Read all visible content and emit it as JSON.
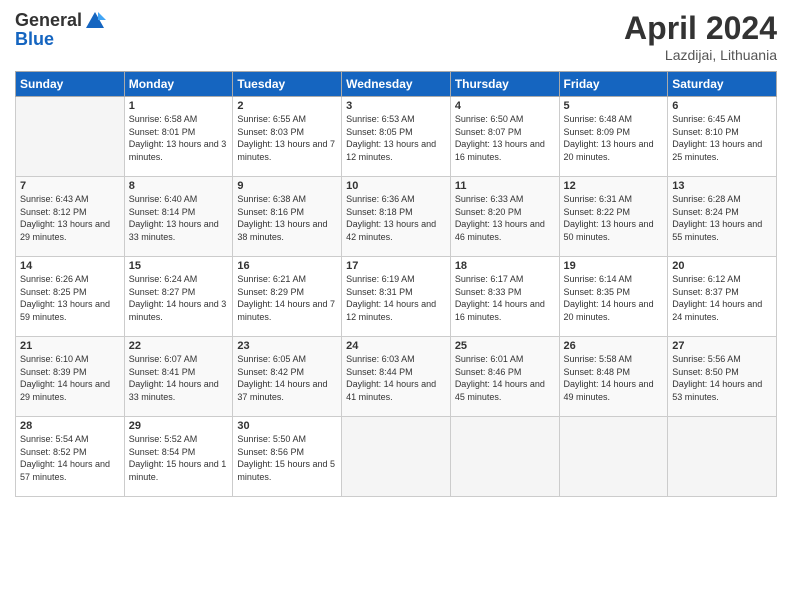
{
  "logo": {
    "general": "General",
    "blue": "Blue"
  },
  "header": {
    "title": "April 2024",
    "subtitle": "Lazdijai, Lithuania"
  },
  "weekdays": [
    "Sunday",
    "Monday",
    "Tuesday",
    "Wednesday",
    "Thursday",
    "Friday",
    "Saturday"
  ],
  "weeks": [
    [
      {
        "day": "",
        "sunrise": "",
        "sunset": "",
        "daylight": ""
      },
      {
        "day": "1",
        "sunrise": "Sunrise: 6:58 AM",
        "sunset": "Sunset: 8:01 PM",
        "daylight": "Daylight: 13 hours and 3 minutes."
      },
      {
        "day": "2",
        "sunrise": "Sunrise: 6:55 AM",
        "sunset": "Sunset: 8:03 PM",
        "daylight": "Daylight: 13 hours and 7 minutes."
      },
      {
        "day": "3",
        "sunrise": "Sunrise: 6:53 AM",
        "sunset": "Sunset: 8:05 PM",
        "daylight": "Daylight: 13 hours and 12 minutes."
      },
      {
        "day": "4",
        "sunrise": "Sunrise: 6:50 AM",
        "sunset": "Sunset: 8:07 PM",
        "daylight": "Daylight: 13 hours and 16 minutes."
      },
      {
        "day": "5",
        "sunrise": "Sunrise: 6:48 AM",
        "sunset": "Sunset: 8:09 PM",
        "daylight": "Daylight: 13 hours and 20 minutes."
      },
      {
        "day": "6",
        "sunrise": "Sunrise: 6:45 AM",
        "sunset": "Sunset: 8:10 PM",
        "daylight": "Daylight: 13 hours and 25 minutes."
      }
    ],
    [
      {
        "day": "7",
        "sunrise": "Sunrise: 6:43 AM",
        "sunset": "Sunset: 8:12 PM",
        "daylight": "Daylight: 13 hours and 29 minutes."
      },
      {
        "day": "8",
        "sunrise": "Sunrise: 6:40 AM",
        "sunset": "Sunset: 8:14 PM",
        "daylight": "Daylight: 13 hours and 33 minutes."
      },
      {
        "day": "9",
        "sunrise": "Sunrise: 6:38 AM",
        "sunset": "Sunset: 8:16 PM",
        "daylight": "Daylight: 13 hours and 38 minutes."
      },
      {
        "day": "10",
        "sunrise": "Sunrise: 6:36 AM",
        "sunset": "Sunset: 8:18 PM",
        "daylight": "Daylight: 13 hours and 42 minutes."
      },
      {
        "day": "11",
        "sunrise": "Sunrise: 6:33 AM",
        "sunset": "Sunset: 8:20 PM",
        "daylight": "Daylight: 13 hours and 46 minutes."
      },
      {
        "day": "12",
        "sunrise": "Sunrise: 6:31 AM",
        "sunset": "Sunset: 8:22 PM",
        "daylight": "Daylight: 13 hours and 50 minutes."
      },
      {
        "day": "13",
        "sunrise": "Sunrise: 6:28 AM",
        "sunset": "Sunset: 8:24 PM",
        "daylight": "Daylight: 13 hours and 55 minutes."
      }
    ],
    [
      {
        "day": "14",
        "sunrise": "Sunrise: 6:26 AM",
        "sunset": "Sunset: 8:25 PM",
        "daylight": "Daylight: 13 hours and 59 minutes."
      },
      {
        "day": "15",
        "sunrise": "Sunrise: 6:24 AM",
        "sunset": "Sunset: 8:27 PM",
        "daylight": "Daylight: 14 hours and 3 minutes."
      },
      {
        "day": "16",
        "sunrise": "Sunrise: 6:21 AM",
        "sunset": "Sunset: 8:29 PM",
        "daylight": "Daylight: 14 hours and 7 minutes."
      },
      {
        "day": "17",
        "sunrise": "Sunrise: 6:19 AM",
        "sunset": "Sunset: 8:31 PM",
        "daylight": "Daylight: 14 hours and 12 minutes."
      },
      {
        "day": "18",
        "sunrise": "Sunrise: 6:17 AM",
        "sunset": "Sunset: 8:33 PM",
        "daylight": "Daylight: 14 hours and 16 minutes."
      },
      {
        "day": "19",
        "sunrise": "Sunrise: 6:14 AM",
        "sunset": "Sunset: 8:35 PM",
        "daylight": "Daylight: 14 hours and 20 minutes."
      },
      {
        "day": "20",
        "sunrise": "Sunrise: 6:12 AM",
        "sunset": "Sunset: 8:37 PM",
        "daylight": "Daylight: 14 hours and 24 minutes."
      }
    ],
    [
      {
        "day": "21",
        "sunrise": "Sunrise: 6:10 AM",
        "sunset": "Sunset: 8:39 PM",
        "daylight": "Daylight: 14 hours and 29 minutes."
      },
      {
        "day": "22",
        "sunrise": "Sunrise: 6:07 AM",
        "sunset": "Sunset: 8:41 PM",
        "daylight": "Daylight: 14 hours and 33 minutes."
      },
      {
        "day": "23",
        "sunrise": "Sunrise: 6:05 AM",
        "sunset": "Sunset: 8:42 PM",
        "daylight": "Daylight: 14 hours and 37 minutes."
      },
      {
        "day": "24",
        "sunrise": "Sunrise: 6:03 AM",
        "sunset": "Sunset: 8:44 PM",
        "daylight": "Daylight: 14 hours and 41 minutes."
      },
      {
        "day": "25",
        "sunrise": "Sunrise: 6:01 AM",
        "sunset": "Sunset: 8:46 PM",
        "daylight": "Daylight: 14 hours and 45 minutes."
      },
      {
        "day": "26",
        "sunrise": "Sunrise: 5:58 AM",
        "sunset": "Sunset: 8:48 PM",
        "daylight": "Daylight: 14 hours and 49 minutes."
      },
      {
        "day": "27",
        "sunrise": "Sunrise: 5:56 AM",
        "sunset": "Sunset: 8:50 PM",
        "daylight": "Daylight: 14 hours and 53 minutes."
      }
    ],
    [
      {
        "day": "28",
        "sunrise": "Sunrise: 5:54 AM",
        "sunset": "Sunset: 8:52 PM",
        "daylight": "Daylight: 14 hours and 57 minutes."
      },
      {
        "day": "29",
        "sunrise": "Sunrise: 5:52 AM",
        "sunset": "Sunset: 8:54 PM",
        "daylight": "Daylight: 15 hours and 1 minute."
      },
      {
        "day": "30",
        "sunrise": "Sunrise: 5:50 AM",
        "sunset": "Sunset: 8:56 PM",
        "daylight": "Daylight: 15 hours and 5 minutes."
      },
      {
        "day": "",
        "sunrise": "",
        "sunset": "",
        "daylight": ""
      },
      {
        "day": "",
        "sunrise": "",
        "sunset": "",
        "daylight": ""
      },
      {
        "day": "",
        "sunrise": "",
        "sunset": "",
        "daylight": ""
      },
      {
        "day": "",
        "sunrise": "",
        "sunset": "",
        "daylight": ""
      }
    ]
  ]
}
